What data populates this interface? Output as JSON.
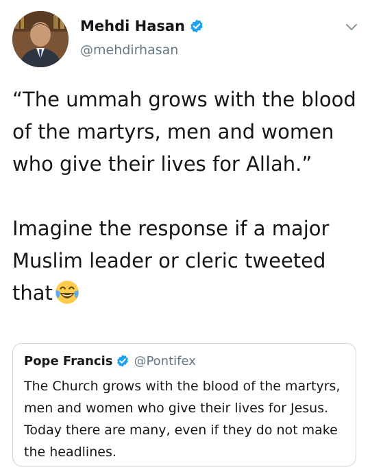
{
  "author": {
    "name": "Mehdi Hasan",
    "handle": "@mehdirhasan",
    "verified": true
  },
  "tweet": {
    "text": "“The ummah grows with the blood of the martyrs, men and women who give their lives for Allah.”\n\nImagine the response if a major Muslim leader or cleric tweeted that",
    "emoji": "face-with-tears-of-joy"
  },
  "quoted_tweet": {
    "name": "Pope Francis",
    "handle": "@Pontifex",
    "verified": true,
    "text": "The Church grows with the blood of the martyrs, men and women who give their lives for Jesus. Today there are many, even if they do not make the headlines."
  },
  "colors": {
    "text": "#14171a",
    "secondary": "#657786",
    "verified_blue": "#1da1f2",
    "border": "#ccd6dd"
  },
  "icons": {
    "verified": "verified-badge-icon",
    "menu": "chevron-down-icon"
  }
}
